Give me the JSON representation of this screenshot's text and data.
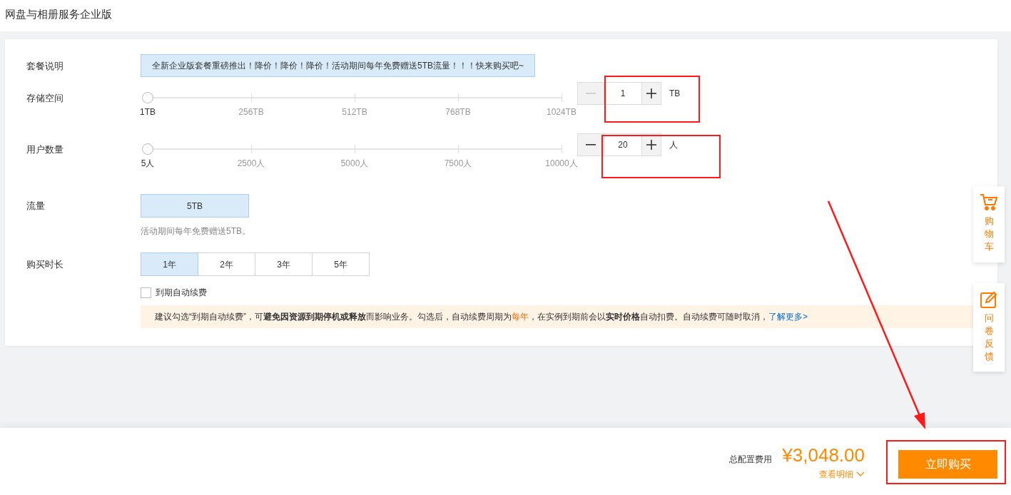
{
  "page_title": "网盘与相册服务企业版",
  "rows": [
    {
      "kind": "banner",
      "label": "套餐说明",
      "text": "全新企业版套餐重磅推出！降价！降价！降价！活动期间每年免费赠送5TB流量！！！快来购买吧~"
    },
    {
      "kind": "slider",
      "label": "存储空间",
      "level": 0,
      "ticks": [
        {
          "label": "1TB",
          "selected": true
        },
        {
          "label": "256TB",
          "selected": false
        },
        {
          "label": "512TB",
          "selected": false
        },
        {
          "label": "768TB",
          "selected": false
        },
        {
          "label": "1024TB",
          "selected": false
        }
      ],
      "value": "1",
      "unit": "TB",
      "minus_disabled": true
    },
    {
      "kind": "slider",
      "label": "用户数量",
      "level": 0,
      "ticks": [
        {
          "label": "5人",
          "selected": true
        },
        {
          "label": "2500人",
          "selected": false
        },
        {
          "label": "5000人",
          "selected": false
        },
        {
          "label": "7500人",
          "selected": false
        },
        {
          "label": "10000人",
          "selected": false
        }
      ],
      "value": "20",
      "unit": "人",
      "minus_disabled": false
    },
    {
      "kind": "options",
      "label": "流量",
      "options": [
        {
          "label": "5TB",
          "selected": true
        }
      ],
      "note": "活动期间每年免费赠送5TB。"
    },
    {
      "kind": "options",
      "label": "购买时长",
      "options": [
        {
          "label": "1年",
          "selected": true
        },
        {
          "label": "2年",
          "selected": false
        },
        {
          "label": "3年",
          "selected": false
        },
        {
          "label": "5年",
          "selected": false
        }
      ]
    }
  ],
  "auto_renew": {
    "label": "到期自动续费",
    "checked": false
  },
  "notice": {
    "parts": [
      {
        "kind": "plain",
        "text": "建议勾选“到期自动续费”，可"
      },
      {
        "kind": "bold",
        "text": "避免因资源到期停机或释放"
      },
      {
        "kind": "plain",
        "text": "而影响业务。勾选后，自动续费周期为 "
      },
      {
        "kind": "highlight",
        "text": "每年"
      },
      {
        "kind": "plain",
        "text": "，在实例到期前会以"
      },
      {
        "kind": "bold",
        "text": "实时价格"
      },
      {
        "kind": "plain",
        "text": "自动扣费。自动续费可随时取消，"
      },
      {
        "kind": "link",
        "text": "了解更多>"
      }
    ]
  },
  "side_buttons": [
    {
      "kind": "cart",
      "label": "购物车"
    },
    {
      "kind": "feedback",
      "label": "问卷反馈"
    }
  ],
  "footer": {
    "total_label": "总配置费用",
    "price": "¥3,048.00",
    "details_link": "查看明细",
    "buy_button": "立即购买"
  }
}
